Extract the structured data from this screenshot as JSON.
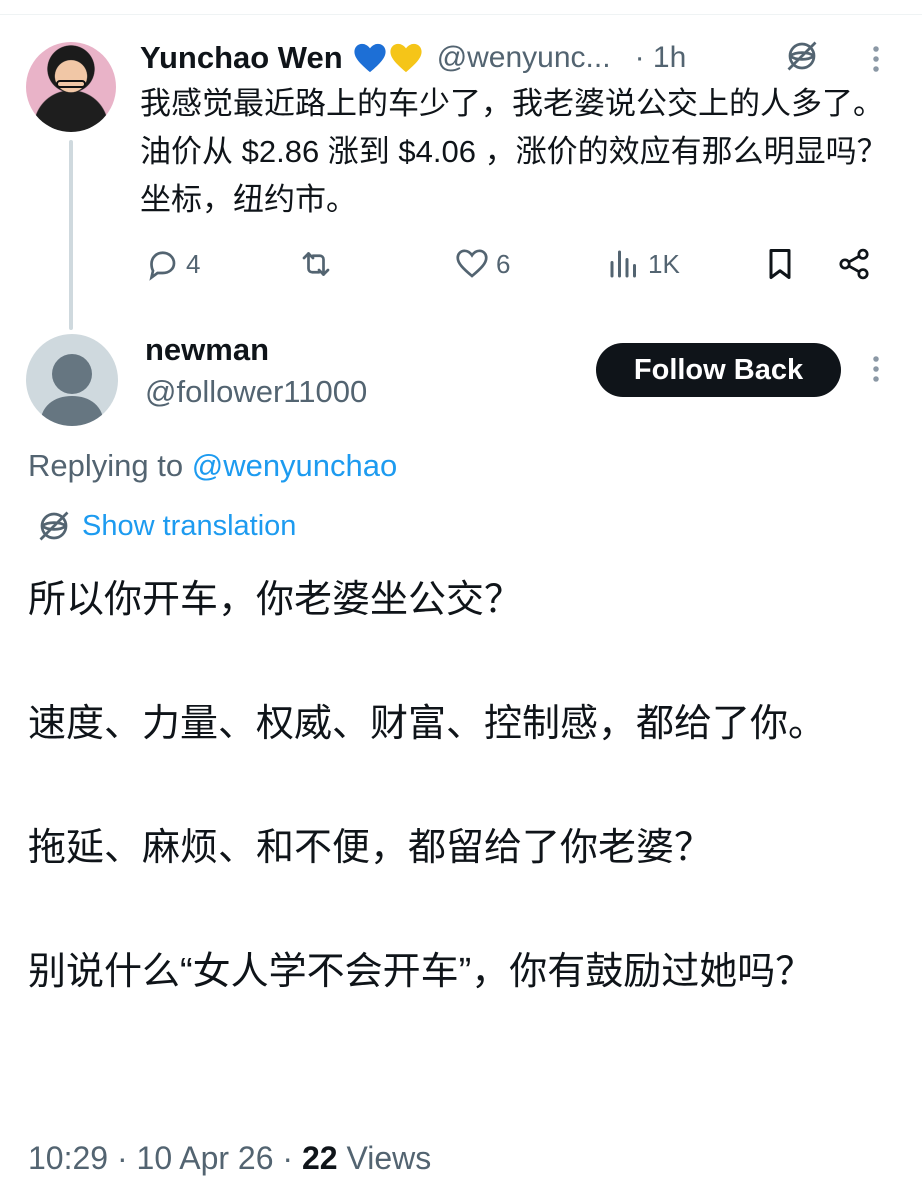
{
  "parent_tweet": {
    "author_name": "Yunchao Wen",
    "author_handle": "@wenyunc...",
    "time": "· 1h",
    "text": "我感觉最近路上的车少了，我老婆说公交上的人多了。油价从 $2.86 涨到 $4.06 ，涨价的效应有那么明显吗？坐标，纽约市。",
    "actions": {
      "replies": "4",
      "retweets": "",
      "likes": "6",
      "views": "1K"
    },
    "heart_colors": [
      "#1d6fd6",
      "#f5c518"
    ]
  },
  "reply_tweet": {
    "author_name": "newman",
    "author_handle": "@follower11000",
    "follow_button": "Follow Back",
    "replying_prefix": "Replying to",
    "replying_to": "@wenyunchao",
    "translation_link": "Show translation",
    "paragraphs": [
      "所以你开车，你老婆坐公交？",
      "速度、力量、权威、财富、控制感，都给了你。",
      "拖延、麻烦、和不便，都留给了你老婆？",
      "别说什么“女人学不会开车”，你有鼓励过她吗？"
    ],
    "time": "10:29",
    "date": "10 Apr 26",
    "view_count": "22",
    "views_label": "Views"
  },
  "colors": {
    "text": "#0f1419",
    "secondary": "#536471",
    "link": "#1d9bf0",
    "divider": "#cfd9de"
  }
}
